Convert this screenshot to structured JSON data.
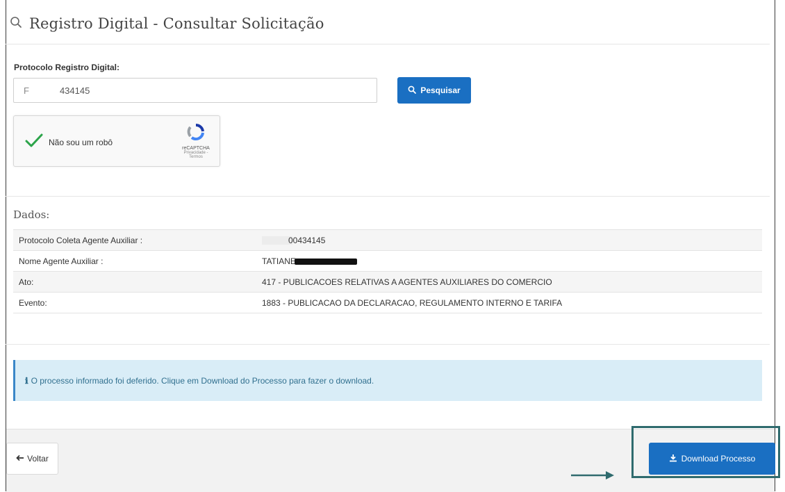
{
  "header": {
    "title": "Registro Digital - Consultar Solicitação",
    "icon": "search-icon"
  },
  "form": {
    "protocolo_label": "Protocolo Registro Digital:",
    "protocolo_prefix": "F",
    "protocolo_value": "434145",
    "search_button": "Pesquisar"
  },
  "captcha": {
    "label": "Não sou um robô",
    "brand": "reCAPTCHA",
    "terms": "Privacidade - Termos",
    "checked": true
  },
  "dados": {
    "title": "Dados:",
    "rows": [
      {
        "label": "Protocolo Coleta Agente Auxiliar :",
        "value": "00434145"
      },
      {
        "label": "Nome Agente Auxiliar :",
        "value": "TATIANE"
      },
      {
        "label": "Ato:",
        "value": "417 - PUBLICACOES RELATIVAS A AGENTES AUXILIARES DO COMERCIO"
      },
      {
        "label": "Evento:",
        "value": "1883 - PUBLICACAO DA DECLARACAO, REGULAMENTO INTERNO E TARIFA"
      }
    ]
  },
  "alert": {
    "text": "O processo informado foi deferido. Clique em Download do Processo para fazer o download."
  },
  "footer": {
    "back_button": "Voltar",
    "download_button": "Download Processo"
  },
  "colors": {
    "primary": "#1a6fc2",
    "alert_bg": "#d9edf7",
    "highlight": "#2f6b6e"
  }
}
